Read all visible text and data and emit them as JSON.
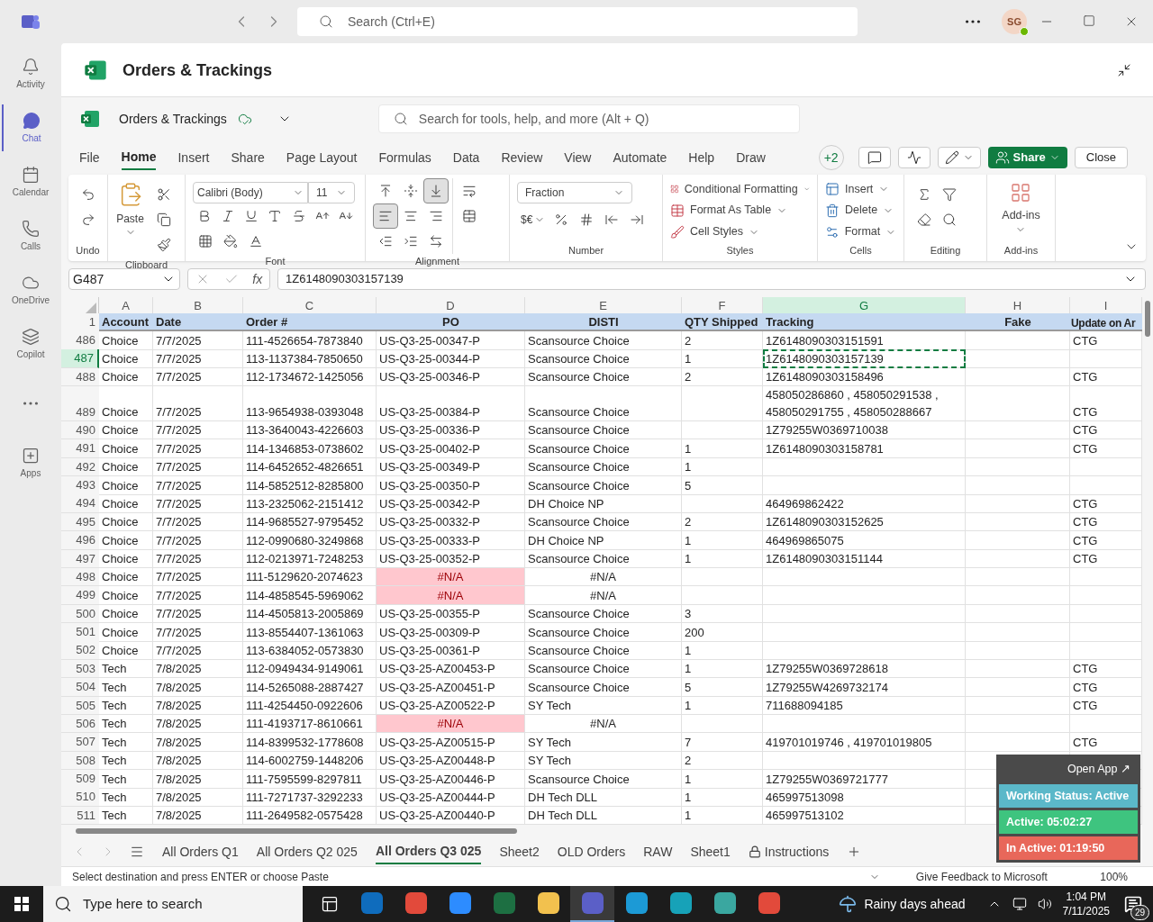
{
  "top_bar": {
    "search_placeholder": "Search (Ctrl+E)",
    "avatar": "SG"
  },
  "rail": [
    {
      "label": "Activity",
      "selected": false
    },
    {
      "label": "Chat",
      "selected": true
    },
    {
      "label": "Calendar",
      "selected": false
    },
    {
      "label": "Calls",
      "selected": false
    },
    {
      "label": "OneDrive",
      "selected": false
    },
    {
      "label": "Copilot",
      "selected": false
    },
    {
      "selected": false
    },
    {
      "label": "Apps",
      "selected": false
    }
  ],
  "page_title": "Orders & Trackings",
  "workbook": {
    "name": "Orders & Trackings",
    "search_placeholder": "Search for tools, help, and more (Alt + Q)"
  },
  "ribbon_tabs": [
    {
      "label": "File",
      "selected": false
    },
    {
      "label": "Home",
      "selected": true
    },
    {
      "label": "Insert",
      "selected": false
    },
    {
      "label": "Share",
      "selected": false
    },
    {
      "label": "Page Layout",
      "selected": false
    },
    {
      "label": "Formulas",
      "selected": false
    },
    {
      "label": "Data",
      "selected": false
    },
    {
      "label": "Review",
      "selected": false
    },
    {
      "label": "View",
      "selected": false
    },
    {
      "label": "Automate",
      "selected": false
    },
    {
      "label": "Help",
      "selected": false
    },
    {
      "label": "Draw",
      "selected": false
    }
  ],
  "header_actions": {
    "collaborators": "+2",
    "share": "Share",
    "close": "Close"
  },
  "ribbon": {
    "undo_group": "Undo",
    "paste": "Paste",
    "clipboard_group": "Clipboard",
    "font": "Calibri (Body)",
    "size": "11",
    "font_group": "Font",
    "align_buttons": [
      {
        "kind": "top",
        "pressed": false
      },
      {
        "kind": "middle",
        "pressed": false
      },
      {
        "kind": "bottom",
        "pressed": true
      },
      {
        "kind": "left",
        "pressed": true
      },
      {
        "kind": "center",
        "pressed": false
      },
      {
        "kind": "right",
        "pressed": false
      }
    ],
    "alignment_group": "Alignment",
    "number_format": "Fraction",
    "currency": "$€",
    "number_group": "Number",
    "styles": [
      "Conditional Formatting",
      "Format As Table",
      "Cell Styles"
    ],
    "styles_group": "Styles",
    "cells": [
      "Insert",
      "Delete",
      "Format"
    ],
    "cells_group": "Cells",
    "editing_group": "Editing",
    "addins": "Add-ins",
    "addins_group": "Add-ins"
  },
  "formula_bar": {
    "name_box": "G487",
    "fx": "fx",
    "value": "1Z6148090303157139"
  },
  "columns": [
    {
      "letter": "A",
      "selected": false
    },
    {
      "letter": "B",
      "selected": false
    },
    {
      "letter": "C",
      "selected": false
    },
    {
      "letter": "D",
      "selected": false
    },
    {
      "letter": "E",
      "selected": false
    },
    {
      "letter": "F",
      "selected": false
    },
    {
      "letter": "G",
      "selected": true
    },
    {
      "letter": "H",
      "selected": false
    },
    {
      "letter": "I",
      "selected": false
    }
  ],
  "header_row": {
    "n": "1",
    "cells": [
      "Account",
      "Date",
      "Order #",
      "PO",
      "DISTI",
      "QTY Shipped",
      "Tracking",
      "Fake",
      "Update on Ar"
    ]
  },
  "rows": [
    {
      "n": "486",
      "selected": false,
      "account": "Choice",
      "date": "7/7/2025",
      "order": "111-4526654-7873840",
      "po": "US-Q3-25-00347-P",
      "po_error": false,
      "disti": "Scansource Choice",
      "qty": "2",
      "tracking": "1Z6148090303151591",
      "update": "CTG"
    },
    {
      "n": "487",
      "selected": true,
      "account": "Choice",
      "date": "7/7/2025",
      "order": "113-1137384-7850650",
      "po": "US-Q3-25-00344-P",
      "po_error": false,
      "disti": "Scansource Choice",
      "qty": "1",
      "tracking": "1Z6148090303157139"
    },
    {
      "n": "488",
      "selected": false,
      "account": "Choice",
      "date": "7/7/2025",
      "order": "112-1734672-1425056",
      "po": "US-Q3-25-00346-P",
      "po_error": false,
      "disti": "Scansource Choice",
      "qty": "2",
      "tracking": "1Z6148090303158496",
      "update": "CTG"
    },
    {
      "n": "489",
      "selected": false,
      "account": "Choice",
      "date": "7/7/2025",
      "order": "113-9654938-0393048",
      "po": "US-Q3-25-00384-P",
      "po_error": false,
      "disti": "Scansource Choice",
      "tracking": "458050286860 , 458050291538 , 458050291755 , 458050288667",
      "update": "CTG"
    },
    {
      "n": "490",
      "selected": false,
      "account": "Choice",
      "date": "7/7/2025",
      "order": "113-3640043-4226603",
      "po": "US-Q3-25-00336-P",
      "po_error": false,
      "disti": "Scansource Choice",
      "tracking": "1Z79255W0369710038",
      "update": "CTG"
    },
    {
      "n": "491",
      "selected": false,
      "account": "Choice",
      "date": "7/7/2025",
      "order": "114-1346853-0738602",
      "po": "US-Q3-25-00402-P",
      "po_error": false,
      "disti": "Scansource Choice",
      "qty": "1",
      "tracking": "1Z6148090303158781",
      "update": "CTG"
    },
    {
      "n": "492",
      "selected": false,
      "account": "Choice",
      "date": "7/7/2025",
      "order": "114-6452652-4826651",
      "po": "US-Q3-25-00349-P",
      "po_error": false,
      "disti": "Scansource Choice",
      "qty": "1"
    },
    {
      "n": "493",
      "selected": false,
      "account": "Choice",
      "date": "7/7/2025",
      "order": "114-5852512-8285800",
      "po": "US-Q3-25-00350-P",
      "po_error": false,
      "disti": "Scansource Choice",
      "qty": "5"
    },
    {
      "n": "494",
      "selected": false,
      "account": "Choice",
      "date": "7/7/2025",
      "order": "113-2325062-2151412",
      "po": "US-Q3-25-00342-P",
      "po_error": false,
      "disti": "DH Choice NP",
      "tracking": "464969862422",
      "update": "CTG"
    },
    {
      "n": "495",
      "selected": false,
      "account": "Choice",
      "date": "7/7/2025",
      "order": "114-9685527-9795452",
      "po": "US-Q3-25-00332-P",
      "po_error": false,
      "disti": "Scansource Choice",
      "qty": "2",
      "tracking": "1Z6148090303152625",
      "update": "CTG"
    },
    {
      "n": "496",
      "selected": false,
      "account": "Choice",
      "date": "7/7/2025",
      "order": "112-0990680-3249868",
      "po": "US-Q3-25-00333-P",
      "po_error": false,
      "disti": "DH Choice NP",
      "qty": "1",
      "tracking": "464969865075",
      "update": "CTG"
    },
    {
      "n": "497",
      "selected": false,
      "account": "Choice",
      "date": "7/7/2025",
      "order": "112-0213971-7248253",
      "po": "US-Q3-25-00352-P",
      "po_error": false,
      "disti": "Scansource Choice",
      "qty": "1",
      "tracking": "1Z6148090303151144",
      "update": "CTG"
    },
    {
      "n": "498",
      "selected": false,
      "account": "Choice",
      "date": "7/7/2025",
      "order": "111-5129620-2074623",
      "po": "#N/A",
      "po_error": true,
      "disti": "#N/A"
    },
    {
      "n": "499",
      "selected": false,
      "account": "Choice",
      "date": "7/7/2025",
      "order": "114-4858545-5969062",
      "po": "#N/A",
      "po_error": true,
      "disti": "#N/A"
    },
    {
      "n": "500",
      "selected": false,
      "account": "Choice",
      "date": "7/7/2025",
      "order": "114-4505813-2005869",
      "po": "US-Q3-25-00355-P",
      "po_error": false,
      "disti": "Scansource Choice",
      "qty": "3"
    },
    {
      "n": "501",
      "selected": false,
      "account": "Choice",
      "date": "7/7/2025",
      "order": "113-8554407-1361063",
      "po": "US-Q3-25-00309-P",
      "po_error": false,
      "disti": "Scansource Choice",
      "qty": "200"
    },
    {
      "n": "502",
      "selected": false,
      "account": "Choice",
      "date": "7/7/2025",
      "order": "113-6384052-0573830",
      "po": "US-Q3-25-00361-P",
      "po_error": false,
      "disti": "Scansource Choice",
      "qty": "1"
    },
    {
      "n": "503",
      "selected": false,
      "account": "Tech",
      "date": "7/8/2025",
      "order": "112-0949434-9149061",
      "po": "US-Q3-25-AZ00453-P",
      "po_error": false,
      "disti": "Scansource Choice",
      "qty": "1",
      "tracking": "1Z79255W0369728618",
      "update": "CTG"
    },
    {
      "n": "504",
      "selected": false,
      "account": "Tech",
      "date": "7/8/2025",
      "order": "114-5265088-2887427",
      "po": "US-Q3-25-AZ00451-P",
      "po_error": false,
      "disti": "Scansource Choice",
      "qty": "5",
      "tracking": "1Z79255W4269732174",
      "update": "CTG"
    },
    {
      "n": "505",
      "selected": false,
      "account": "Tech",
      "date": "7/8/2025",
      "order": "111-4254450-0922606",
      "po": "US-Q3-25-AZ00522-P",
      "po_error": false,
      "disti": "SY Tech",
      "qty": "1",
      "tracking": "711688094185",
      "update": "CTG"
    },
    {
      "n": "506",
      "selected": false,
      "account": "Tech",
      "date": "7/8/2025",
      "order": "111-4193717-8610661",
      "po": "#N/A",
      "po_error": true,
      "disti": "#N/A"
    },
    {
      "n": "507",
      "selected": false,
      "account": "Tech",
      "date": "7/8/2025",
      "order": "114-8399532-1778608",
      "po": "US-Q3-25-AZ00515-P",
      "po_error": false,
      "disti": "SY Tech",
      "qty": "7",
      "tracking": "419701019746 , 419701019805",
      "update": "CTG"
    },
    {
      "n": "508",
      "selected": false,
      "account": "Tech",
      "date": "7/8/2025",
      "order": "114-6002759-1448206",
      "po": "US-Q3-25-AZ00448-P",
      "po_error": false,
      "disti": "SY Tech",
      "qty": "2"
    },
    {
      "n": "509",
      "selected": false,
      "account": "Tech",
      "date": "7/8/2025",
      "order": "111-7595599-8297811",
      "po": "US-Q3-25-AZ00446-P",
      "po_error": false,
      "disti": "Scansource Choice",
      "qty": "1",
      "tracking": "1Z79255W0369721777"
    },
    {
      "n": "510",
      "selected": false,
      "account": "Tech",
      "date": "7/8/2025",
      "order": "111-7271737-3292233",
      "po": "US-Q3-25-AZ00444-P",
      "po_error": false,
      "disti": "DH Tech DLL",
      "qty": "1",
      "tracking": "465997513098"
    },
    {
      "n": "511",
      "selected": false,
      "account": "Tech",
      "date": "7/8/2025",
      "order": "111-2649582-0575428",
      "po": "US-Q3-25-AZ00440-P",
      "po_error": false,
      "disti": "DH Tech DLL",
      "qty": "1",
      "tracking": "465997513102"
    }
  ],
  "sheet_tabs": [
    {
      "label": "All Orders Q1",
      "selected": false,
      "locked": false
    },
    {
      "label": "All Orders Q2 025",
      "selected": false,
      "locked": false
    },
    {
      "label": "All Orders Q3 025",
      "selected": true,
      "locked": false
    },
    {
      "label": "Sheet2",
      "selected": false,
      "locked": false
    },
    {
      "label": "OLD Orders",
      "selected": false,
      "locked": false
    },
    {
      "label": "RAW",
      "selected": false,
      "locked": false
    },
    {
      "label": "Sheet1",
      "selected": false,
      "locked": false
    },
    {
      "label": "Instructions",
      "selected": false,
      "locked": true
    }
  ],
  "status_bar": {
    "message": "Select destination and press ENTER or choose Paste",
    "feedback": "Give Feedback to Microsoft",
    "zoom": "100%"
  },
  "status_widget": {
    "open_app": "Open App ↗",
    "items": [
      {
        "text": "Working Status: Active",
        "color": "#5bb8c9"
      },
      {
        "text": "Active: 05:02:27",
        "color": "#3ec47f"
      },
      {
        "text": "In Active: 01:19:50",
        "color": "#e8675a"
      }
    ]
  },
  "taskbar": {
    "search_placeholder": "Type here to search",
    "apps": [
      {
        "color": "#0f6cbd",
        "active": false
      },
      {
        "color": "#e24a3b",
        "active": false
      },
      {
        "color": "#2d8cff",
        "active": false
      },
      {
        "color": "#1d6f42",
        "active": false
      },
      {
        "color": "#f2c14e",
        "active": false
      },
      {
        "color": "#5b5fc7",
        "active": true
      },
      {
        "color": "#1c9ad6",
        "active": false
      },
      {
        "color": "#17a2b8",
        "active": false
      },
      {
        "color": "#3aa7a0",
        "active": false
      },
      {
        "color": "#e24a3b",
        "active": false
      }
    ],
    "weather": "Rainy days ahead",
    "time": "1:04 PM",
    "date": "7/11/2025",
    "notifications": "29"
  }
}
